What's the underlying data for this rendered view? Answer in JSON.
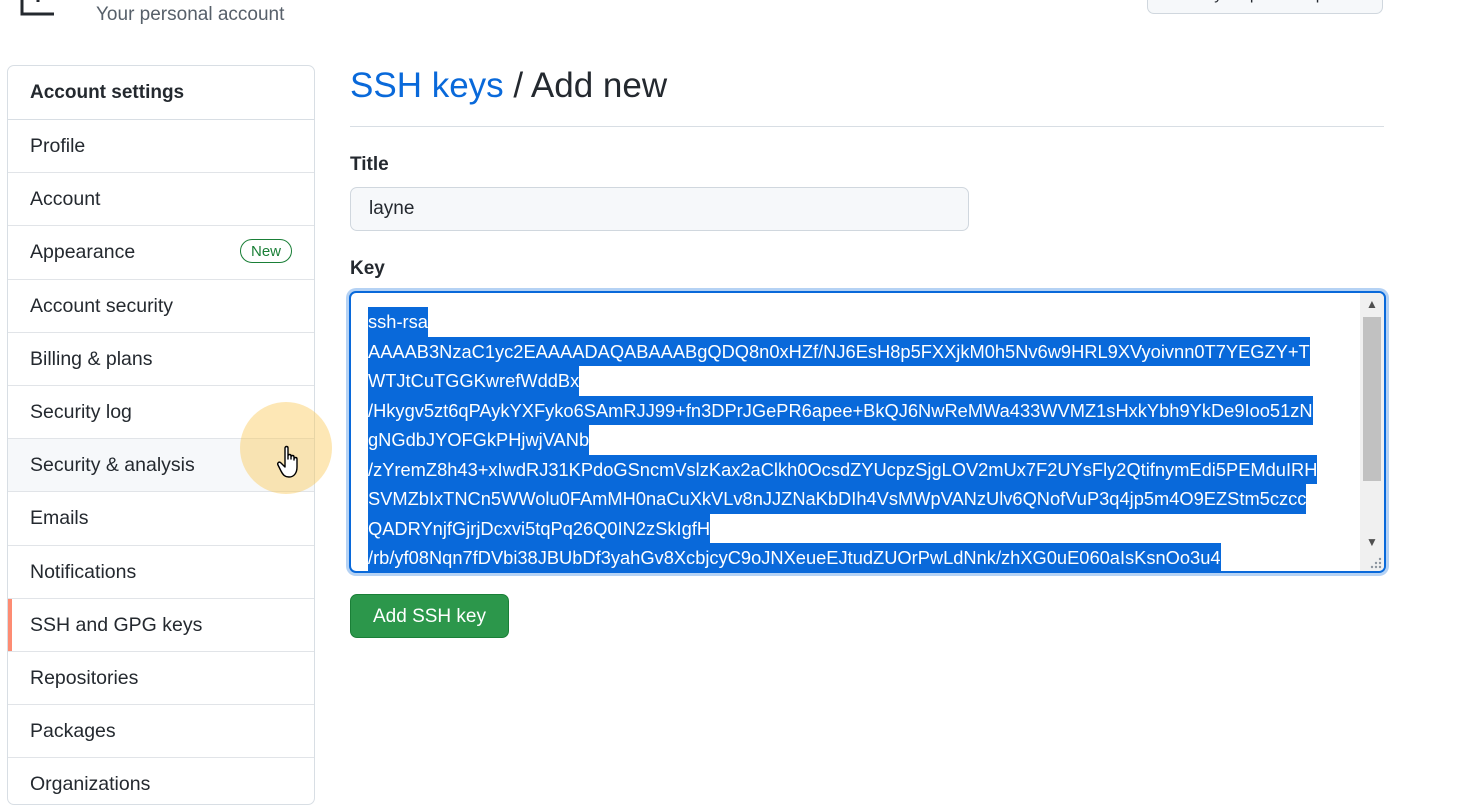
{
  "header": {
    "subtitle": "Your personal account",
    "profile_button": "Go to your personal profile"
  },
  "sidebar": {
    "header": "Account settings",
    "items": [
      {
        "label": "Profile"
      },
      {
        "label": "Account"
      },
      {
        "label": "Appearance",
        "badge": "New"
      },
      {
        "label": "Account security"
      },
      {
        "label": "Billing & plans"
      },
      {
        "label": "Security log"
      },
      {
        "label": "Security & analysis"
      },
      {
        "label": "Emails"
      },
      {
        "label": "Notifications"
      },
      {
        "label": "SSH and GPG keys",
        "selected": true
      },
      {
        "label": "Repositories"
      },
      {
        "label": "Packages"
      },
      {
        "label": "Organizations"
      }
    ]
  },
  "main": {
    "breadcrumb_link": "SSH keys",
    "breadcrumb_current": "/ Add new",
    "title_label": "Title",
    "title_value": "layne",
    "key_label": "Key",
    "key_lines": [
      "ssh-rsa",
      "AAAAB3NzaC1yc2EAAAADAQABAAABgQDQ8n0xHZf/NJ6EsH8p5FXXjkM0h5Nv6w9HRL9XVyoivnn0T7YEGZY+T",
      "WTJtCuTGGKwrefWddBx",
      "/Hkygv5zt6qPAykYXFyko6SAmRJJ99+fn3DPrJGePR6apee+BkQJ6NwReMWa433WVMZ1sHxkYbh9YkDe9Ioo51zN",
      "gNGdbJYOFGkPHjwjVANb",
      "/zYremZ8h43+xIwdRJ31KPdoGSncmVslzKax2aClkh0OcsdZYUcpzSjgLOV2mUx7F2UYsFly2QtifnymEdi5PEMduIRH",
      "SVMZbIxTNCn5WWolu0FAmMH0naCuXkVLv8nJJZNaKbDIh4VsMWpVANzUlv6QNofVuP3q4jp5m4O9EZStm5czcc",
      "QADRYnjfGjrjDcxvi5tqPq26Q0IN2zSkIgfH",
      "/rb/yf08Nqn7fDVbi38JBUbDf3yahGv8XcbjcyC9oJNXeueEJtudZUOrPwLdNnk/zhXG0uE060aIsKsnOo3u4"
    ],
    "submit_label": "Add SSH key"
  },
  "colors": {
    "link": "#0969da",
    "selection": "#0969da",
    "button_green": "#2c974b",
    "selected_marker": "#fd8c73",
    "badge_green": "#1a7f37"
  }
}
